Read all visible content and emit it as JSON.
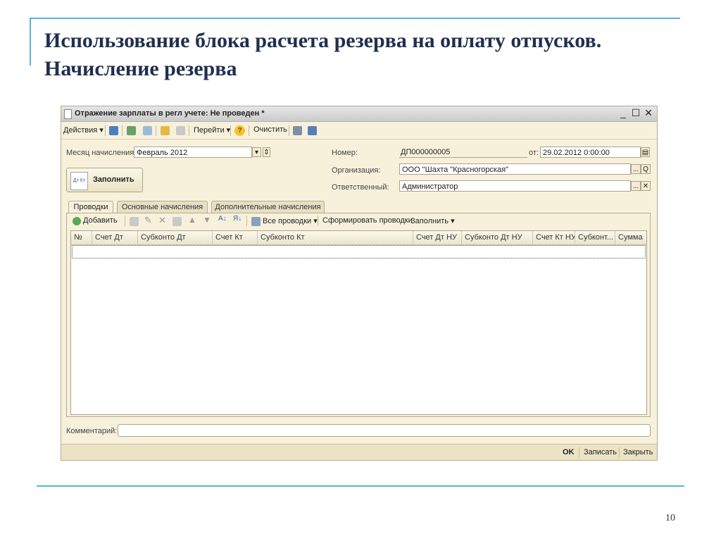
{
  "slide": {
    "title_line1": "Использование блока расчета резерва на оплату отпусков.",
    "title_line2": "Начисление резерва",
    "page_number": "10"
  },
  "window": {
    "title": "Отражение зарплаты в регл учете: Не проведен *",
    "minimize": "_",
    "maximize": "☐",
    "close": "✕"
  },
  "toolbar": {
    "actions": "Действия",
    "goto": "Перейти",
    "help": "?",
    "clear": "Очистить"
  },
  "form": {
    "month_label": "Месяц начисления:",
    "month_value": "Февраль 2012",
    "number_label": "Номер:",
    "number_value": "ДП000000005",
    "date_label": "от:",
    "date_value": "29.02.2012  0:00:00",
    "org_label": "Организация:",
    "org_value": "ООО \"Шахта \"Красногорская\"",
    "resp_label": "Ответственный:",
    "resp_value": "Администратор",
    "fill_button": "Заполнить",
    "fill_icon_text": "Дт Кт",
    "ellipsis": "...",
    "search_glyph": "Q",
    "clear_glyph": "✕"
  },
  "tabs": [
    {
      "label": "Проводки",
      "active": true
    },
    {
      "label": "Основные начисления",
      "active": false
    },
    {
      "label": "Дополнительные начисления",
      "active": false
    }
  ],
  "table_toolbar": {
    "add": "Добавить",
    "all_entries": "Все проводки",
    "form_entries": "Сформировать проводки",
    "fill": "Заполнить"
  },
  "table": {
    "columns": [
      "№",
      "Счет Дт",
      "Субконто Дт",
      "Счет Кт",
      "Субконто Кт",
      "Счет Дт НУ",
      "Субконто Дт НУ",
      "Счет Кт НУ",
      "Субконт...",
      "Сумма"
    ]
  },
  "comment": {
    "label": "Комментарий:"
  },
  "footer": {
    "ok": "OK",
    "save": "Записать",
    "close": "Закрыть"
  },
  "colors": {
    "accent_line": "#5bb4d7",
    "title_text": "#1f2f4f",
    "form_bg": "#f7f1dc"
  }
}
